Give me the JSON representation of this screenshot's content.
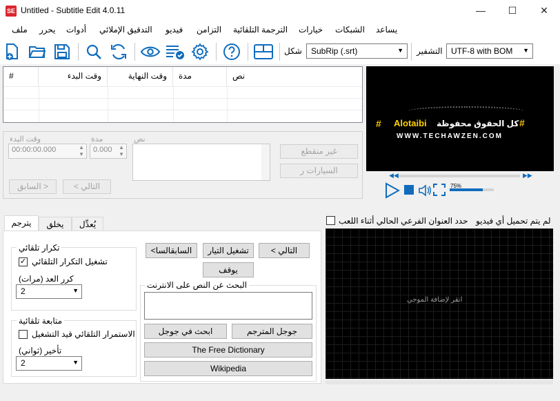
{
  "window": {
    "title": "Untitled - Subtitle Edit 4.0.11",
    "app_icon_glyph": "SE",
    "minimize": "—",
    "maximize": "☐",
    "close": "✕"
  },
  "menu": {
    "items": [
      "ملف",
      "يحرر",
      "أدوات",
      "التدقيق الإملائي",
      "فيديو",
      "التزامن",
      "الترجمة التلقائية",
      "خيارات",
      "الشبكات",
      "يساعد"
    ]
  },
  "toolbar": {
    "icons": [
      "new-file-icon",
      "open-folder-icon",
      "save-icon",
      "find-icon",
      "replace-icon",
      "visual-sync-icon",
      "spell-check-icon",
      "settings-icon",
      "help-icon",
      "layout-icon"
    ],
    "format_label": "شكل",
    "format_value": "SubRip (.srt)",
    "encoding_label": "التشفير",
    "encoding_value": "UTF-8 with BOM",
    "accent": "#0f6cbd"
  },
  "grid": {
    "columns": [
      "#",
      "وقت البدء",
      "وقت النهاية",
      "مدة",
      "نص"
    ]
  },
  "edit": {
    "start_label": "وقت البدء",
    "start_value": "00:00:00.000",
    "duration_label": "مدة",
    "duration_value": "0.000",
    "text_label": "نص",
    "unbreak_button": "غير منقطع",
    "cars_button": "السيارات ر",
    "prev_button": "السابق >",
    "next_button": "< التالي"
  },
  "video": {
    "watermark_line1": "Alotaibi",
    "watermark_line2": "كل الحقوق محفوظة",
    "watermark_hash": "#",
    "watermark_url": "WWW.TECHAWZEN.COM",
    "volume_label": "75%",
    "volume_level": 0.75
  },
  "tabs": {
    "items": [
      "يترجم",
      "يخلق",
      "يُعدِّل"
    ],
    "active": 0
  },
  "translate": {
    "auto_repeat_title": "تكرار تلقائي",
    "auto_repeat_check_label": "تشغيل التكرار التلقائي",
    "auto_repeat_checked": true,
    "repeat_count_label": "كرر العد (مرات)",
    "repeat_count_value": "2",
    "auto_continue_title": "متابعة تلقائية",
    "auto_continue_check_label": "الاستمرار التلقائي قيد التشغيل",
    "auto_continue_checked": false,
    "delay_label": "تأخير (ثواني)",
    "delay_value": "2",
    "prev_button": "<السابقالسا",
    "play_current_button": "تشغيل التيار",
    "next_button": "< التالي",
    "stop_button": "يوقف",
    "search_title": "البحث عن النص على الانترنت",
    "google_translate_button": "جوجل المترجم",
    "google_search_button": "ابحث في جوجل",
    "free_dictionary_button": "The Free Dictionary",
    "wikipedia_button": "Wikipedia"
  },
  "waveform": {
    "no_video_label": "لم يتم تحميل أي فيديو",
    "select_current_label": "حدد العنوان الفرعي الحالي أثناء اللعب",
    "select_current_checked": false,
    "click_to_add_label": "انقر لإضافة الموجي"
  }
}
